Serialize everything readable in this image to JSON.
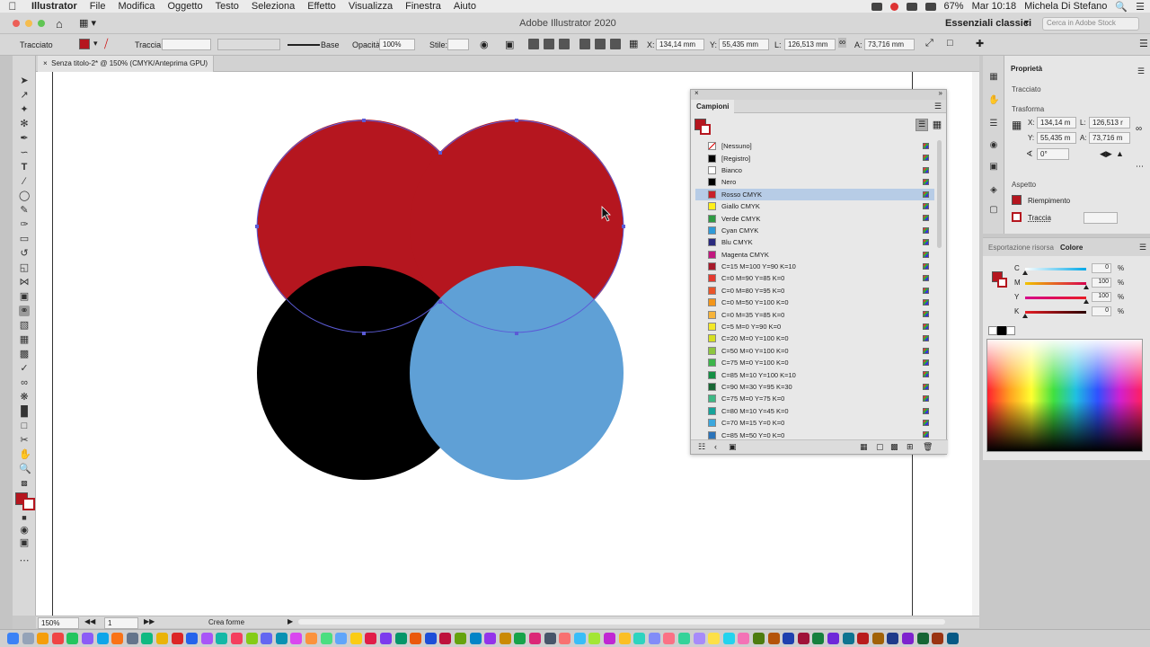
{
  "menubar": {
    "app": "Illustrator",
    "items": [
      "File",
      "Modifica",
      "Oggetto",
      "Testo",
      "Seleziona",
      "Effetto",
      "Visualizza",
      "Finestra",
      "Aiuto"
    ],
    "battery": "67%",
    "clock": "Mar 10:18",
    "user": "Michela Di Stefano"
  },
  "appbar": {
    "title": "Adobe Illustrator 2020",
    "workspace": "Essenziali classici",
    "search_placeholder": "Cerca in Adobe Stock"
  },
  "control": {
    "selection_label": "Tracciato",
    "stroke_label": "Traccia:",
    "brush_label": "Base",
    "opacity_label": "Opacità:",
    "opacity_value": "100%",
    "style_label": "Stile:",
    "x_label": "X:",
    "x_value": "134,14 mm",
    "y_label": "Y:",
    "y_value": "55,435 mm",
    "w_label": "L:",
    "w_value": "126,513 mm",
    "h_label": "A:",
    "h_value": "73,716 mm",
    "fill_color": "#b5161f"
  },
  "document": {
    "tab_title": "Senza titolo-2* @ 150% (CMYK/Anteprima GPU)"
  },
  "canvas": {
    "red_fill": "#b5161f",
    "black_fill": "#000000",
    "blue_fill": "#5fa0d6",
    "selection_color": "#5b5bd6"
  },
  "swatches_panel": {
    "title": "Campioni",
    "selected_index": 4,
    "items": [
      {
        "name": "[Nessuno]",
        "color": "none"
      },
      {
        "name": "[Registro]",
        "color": "#000000"
      },
      {
        "name": "Bianco",
        "color": "#ffffff"
      },
      {
        "name": "Nero",
        "color": "#000000"
      },
      {
        "name": "Rosso CMYK",
        "color": "#c8202a"
      },
      {
        "name": "Giallo CMYK",
        "color": "#ffef1a"
      },
      {
        "name": "Verde CMYK",
        "color": "#2e9a43"
      },
      {
        "name": "Cyan CMYK",
        "color": "#2f9ad8"
      },
      {
        "name": "Blu CMYK",
        "color": "#2a2a7e"
      },
      {
        "name": "Magenta CMYK",
        "color": "#c2177e"
      },
      {
        "name": "C=15 M=100 Y=90 K=10",
        "color": "#a7192a"
      },
      {
        "name": "C=0 M=90 Y=85 K=0",
        "color": "#e53a2f"
      },
      {
        "name": "C=0 M=80 Y=95 K=0",
        "color": "#e9552a"
      },
      {
        "name": "C=0 M=50 Y=100 K=0",
        "color": "#f39519"
      },
      {
        "name": "C=0 M=35 Y=85 K=0",
        "color": "#f7b338"
      },
      {
        "name": "C=5 M=0 Y=90 K=0",
        "color": "#f3e827"
      },
      {
        "name": "C=20 M=0 Y=100 K=0",
        "color": "#d6df21"
      },
      {
        "name": "C=50 M=0 Y=100 K=0",
        "color": "#8dc63f"
      },
      {
        "name": "C=75 M=0 Y=100 K=0",
        "color": "#3cb54a"
      },
      {
        "name": "C=85 M=10 Y=100 K=10",
        "color": "#138f43"
      },
      {
        "name": "C=90 M=30 Y=95 K=30",
        "color": "#176734"
      },
      {
        "name": "C=75 M=0 Y=75 K=0",
        "color": "#3db884"
      },
      {
        "name": "C=80 M=10 Y=45 K=0",
        "color": "#16a39a"
      },
      {
        "name": "C=70 M=15 Y=0 K=0",
        "color": "#3ba7dd"
      },
      {
        "name": "C=85 M=50 Y=0 K=0",
        "color": "#2b74ba"
      }
    ]
  },
  "properties_panel": {
    "tab": "Proprietà",
    "object_type": "Tracciato",
    "transform_label": "Trasforma",
    "x_label": "X:",
    "x_value": "134,14 m",
    "y_label": "Y:",
    "y_value": "55,435 m",
    "w_label": "L:",
    "w_value": "126,513 r",
    "h_label": "A:",
    "h_value": "73,716 m",
    "angle_value": "0°",
    "appearance_label": "Aspetto",
    "fill_label": "Riempimento",
    "stroke_label": "Traccia"
  },
  "color_panel": {
    "tab_inactive": "Esportazione risorsa",
    "tab_active": "Colore",
    "channels": [
      {
        "label": "C",
        "value": "0",
        "level": 0.0,
        "gradient": "linear-gradient(to right, #fff, #00a8e8)"
      },
      {
        "label": "M",
        "value": "100",
        "level": 1.0,
        "gradient": "linear-gradient(to right, #f2c400, #d6004f)"
      },
      {
        "label": "Y",
        "value": "100",
        "level": 1.0,
        "gradient": "linear-gradient(to right, #d6008b, #e81e25)"
      },
      {
        "label": "K",
        "value": "0",
        "level": 0.0,
        "gradient": "linear-gradient(to right, #e81e25, #2a0000)"
      }
    ],
    "unit": "%"
  },
  "statusbar": {
    "zoom": "150%",
    "artboard_num": "1",
    "tool_name": "Crea forme"
  }
}
